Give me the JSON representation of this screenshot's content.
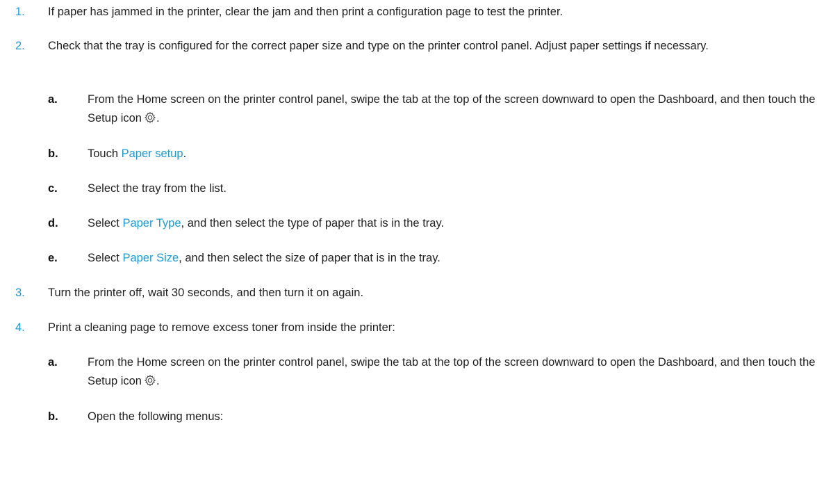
{
  "colors": {
    "accent": "#1a9bd7",
    "text": "#1f1f1f"
  },
  "steps": [
    {
      "num": "1.",
      "text": "If paper has jammed in the printer, clear the jam and then print a configuration page to test the printer."
    },
    {
      "num": "2.",
      "text": "Check that the tray is configured for the correct paper size and type on the printer control panel. Adjust paper settings if necessary.",
      "substeps": [
        {
          "num": "a.",
          "text_before": "From the Home screen on the printer control panel, swipe the tab at the top of the screen downward to open the Dashboard, and then touch the Setup icon",
          "text_after": ".",
          "icon": "gear-icon"
        },
        {
          "num": "b.",
          "text_before": "Touch ",
          "link": "Paper setup",
          "text_after": "."
        },
        {
          "num": "c.",
          "text": "Select the tray from the list."
        },
        {
          "num": "d.",
          "text_before": "Select ",
          "link": "Paper Type",
          "text_after": ", and then select the type of paper that is in the tray."
        },
        {
          "num": "e.",
          "text_before": "Select ",
          "link": "Paper Size",
          "text_after": ", and then select the size of paper that is in the tray."
        }
      ]
    },
    {
      "num": "3.",
      "text": "Turn the printer off, wait 30 seconds, and then turn it on again."
    },
    {
      "num": "4.",
      "text": "Print a cleaning page to remove excess toner from inside the printer:",
      "substeps": [
        {
          "num": "a.",
          "text_before": "From the Home screen on the printer control panel, swipe the tab at the top of the screen downward to open the Dashboard, and then touch the Setup icon",
          "text_after": ".",
          "icon": "gear-icon"
        },
        {
          "num": "b.",
          "text": "Open the following menus:"
        }
      ]
    }
  ]
}
